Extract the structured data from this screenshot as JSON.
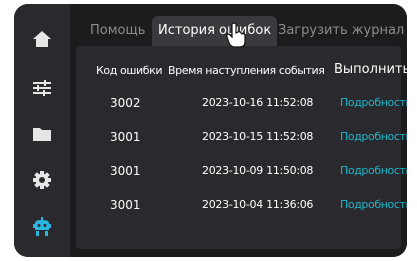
{
  "sidebar": {
    "items": [
      {
        "icon": "home-icon"
      },
      {
        "icon": "sliders-icon"
      },
      {
        "icon": "folder-icon"
      },
      {
        "icon": "gear-icon"
      },
      {
        "icon": "robot-icon"
      }
    ],
    "active_color": "#2ab6e0"
  },
  "tabs": [
    {
      "label": "Помощь"
    },
    {
      "label": "История ошибок"
    },
    {
      "label": "Загрузить журнал"
    }
  ],
  "table": {
    "headers": {
      "code": "Код ошибки",
      "time": "Время наступления события",
      "action": "Выполнить"
    },
    "rows": [
      {
        "code": "3002",
        "time": "2023-10-16 11:52:08",
        "action": "Подробности"
      },
      {
        "code": "3001",
        "time": "2023-10-15 11:52:08",
        "action": "Подробности"
      },
      {
        "code": "3001",
        "time": "2023-10-09 11:50:08",
        "action": "Подробности"
      },
      {
        "code": "3001",
        "time": "2023-10-04 11:36:06",
        "action": "Подробности"
      }
    ]
  },
  "colors": {
    "link": "#1fb4c8",
    "background": "#1c1c1e",
    "panel": "#2a2a2e"
  }
}
